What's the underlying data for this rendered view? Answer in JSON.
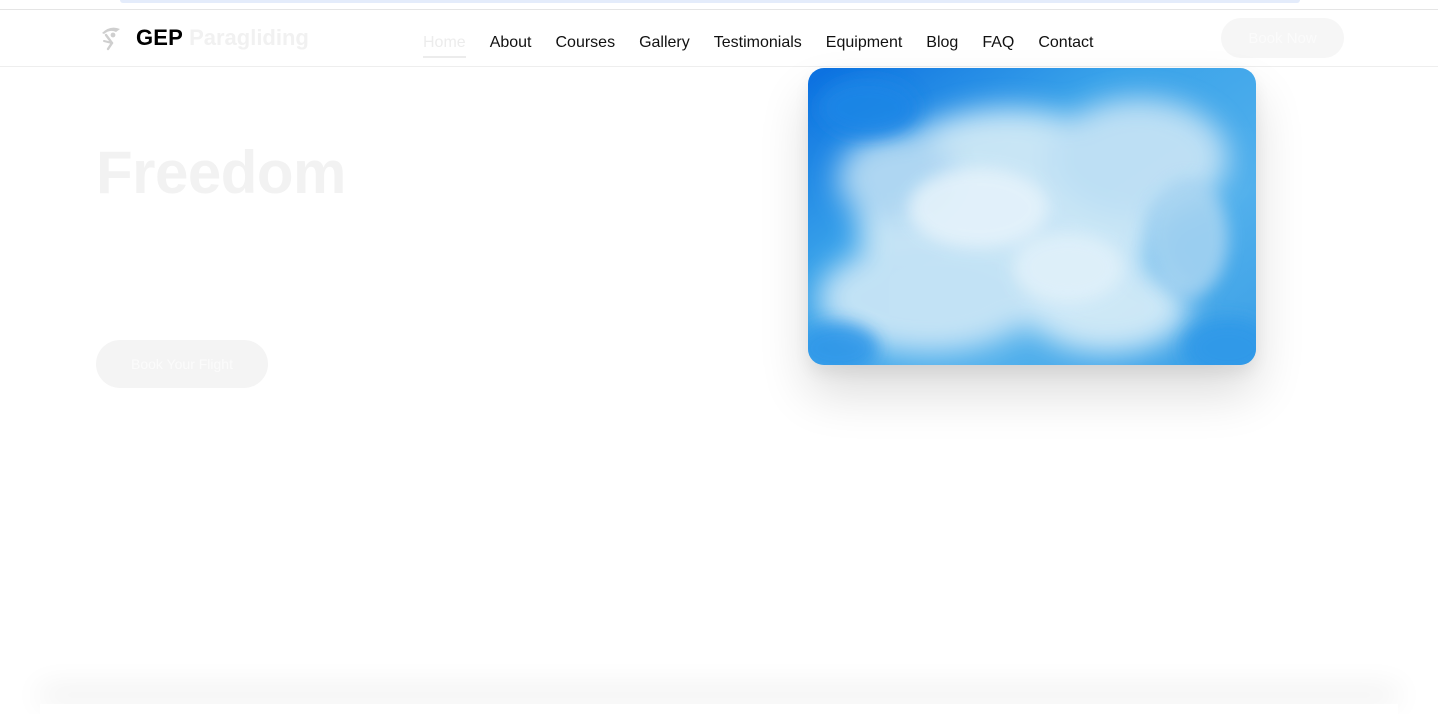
{
  "brand": {
    "name_strong": "GEP",
    "name_light": "Paragliding",
    "icon": "paraglider-icon"
  },
  "nav": {
    "items": [
      {
        "label": "Home",
        "active": true
      },
      {
        "label": "About"
      },
      {
        "label": "Courses"
      },
      {
        "label": "Gallery"
      },
      {
        "label": "Testimonials"
      },
      {
        "label": "Equipment"
      },
      {
        "label": "Blog"
      },
      {
        "label": "FAQ"
      },
      {
        "label": "Contact"
      }
    ],
    "cta_label": "Book Now"
  },
  "hero": {
    "title": "Freedom",
    "cta_label": "Book Your Flight",
    "image": "sky-clouds-image"
  },
  "colors": {
    "sky_deep": "#0a6fe0",
    "sky_mid": "#3aa3ea",
    "cloud": "#d4ebf7"
  }
}
